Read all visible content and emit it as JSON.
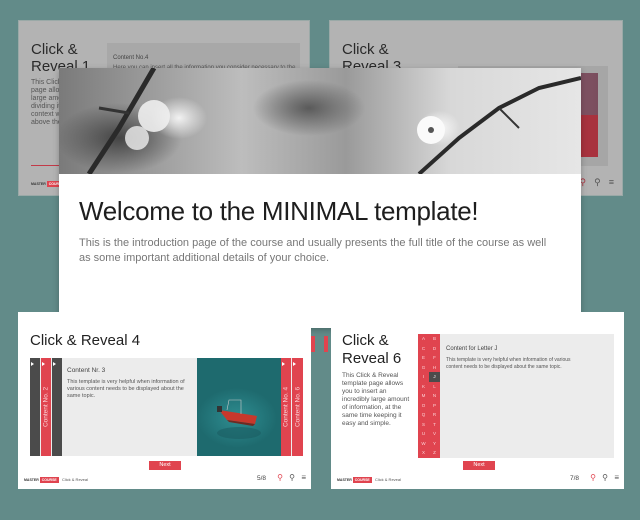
{
  "colors": {
    "background": "#628b89",
    "accent": "#e0444f",
    "dark_tab": "#4b4b4b"
  },
  "brand": {
    "part1": "MASTER",
    "part2": "COURSE"
  },
  "slides": {
    "reveal1": {
      "title": "Click & Reveal 1",
      "description": "This Click & Reveal template page allows you to insert a large amount of information dividing it into sections. This context will be displayed above the button by",
      "content_heading": "Content No.4",
      "content_text": "Here you can insert all the information you consider necessary to the"
    },
    "reveal3": {
      "title": "Click & Reveal 3"
    },
    "intro": {
      "headline": "Welcome to the MINIMAL template!",
      "text": "This is the introduction page of the course and usually presents the full title of the course as well as some important additional details of your choice."
    },
    "reveal4": {
      "title": "Click & Reveal 4",
      "tabs_left": [
        "",
        "Content No. 2",
        ""
      ],
      "tabs_right": [
        "Content No. 4",
        "Content No. 6"
      ],
      "content_heading": "Content Nr. 3",
      "content_text": "This template is very helpful when information of various content needs to be displayed about the same topic.",
      "next_label": "Next",
      "breadcrumb": "Click & Reveal",
      "page_indicator": "5/8"
    },
    "reveal6": {
      "title": "Click & Reveal 6",
      "description": "This Click & Reveal template page allows you to insert an incredibly large amount of information, at the same time keeping it easy and simple.",
      "letters": [
        "A",
        "B",
        "C",
        "D",
        "E",
        "F",
        "G",
        "H",
        "I",
        "J",
        "K",
        "L",
        "M",
        "N",
        "O",
        "P",
        "Q",
        "R",
        "S",
        "T",
        "U",
        "V",
        "W",
        "Y",
        "X",
        "Z"
      ],
      "active_letter": "J",
      "content_heading": "Content for Letter J",
      "content_text": "This template is very helpful when information of various content needs to be displayed about the same topic.",
      "next_label": "Next",
      "breadcrumb": "Click & Reveal",
      "page_indicator": "7/8"
    }
  },
  "icons": {
    "hint": "lightbulb-icon",
    "help": "lightbulb-outline-icon",
    "menu": "menu-icon"
  }
}
